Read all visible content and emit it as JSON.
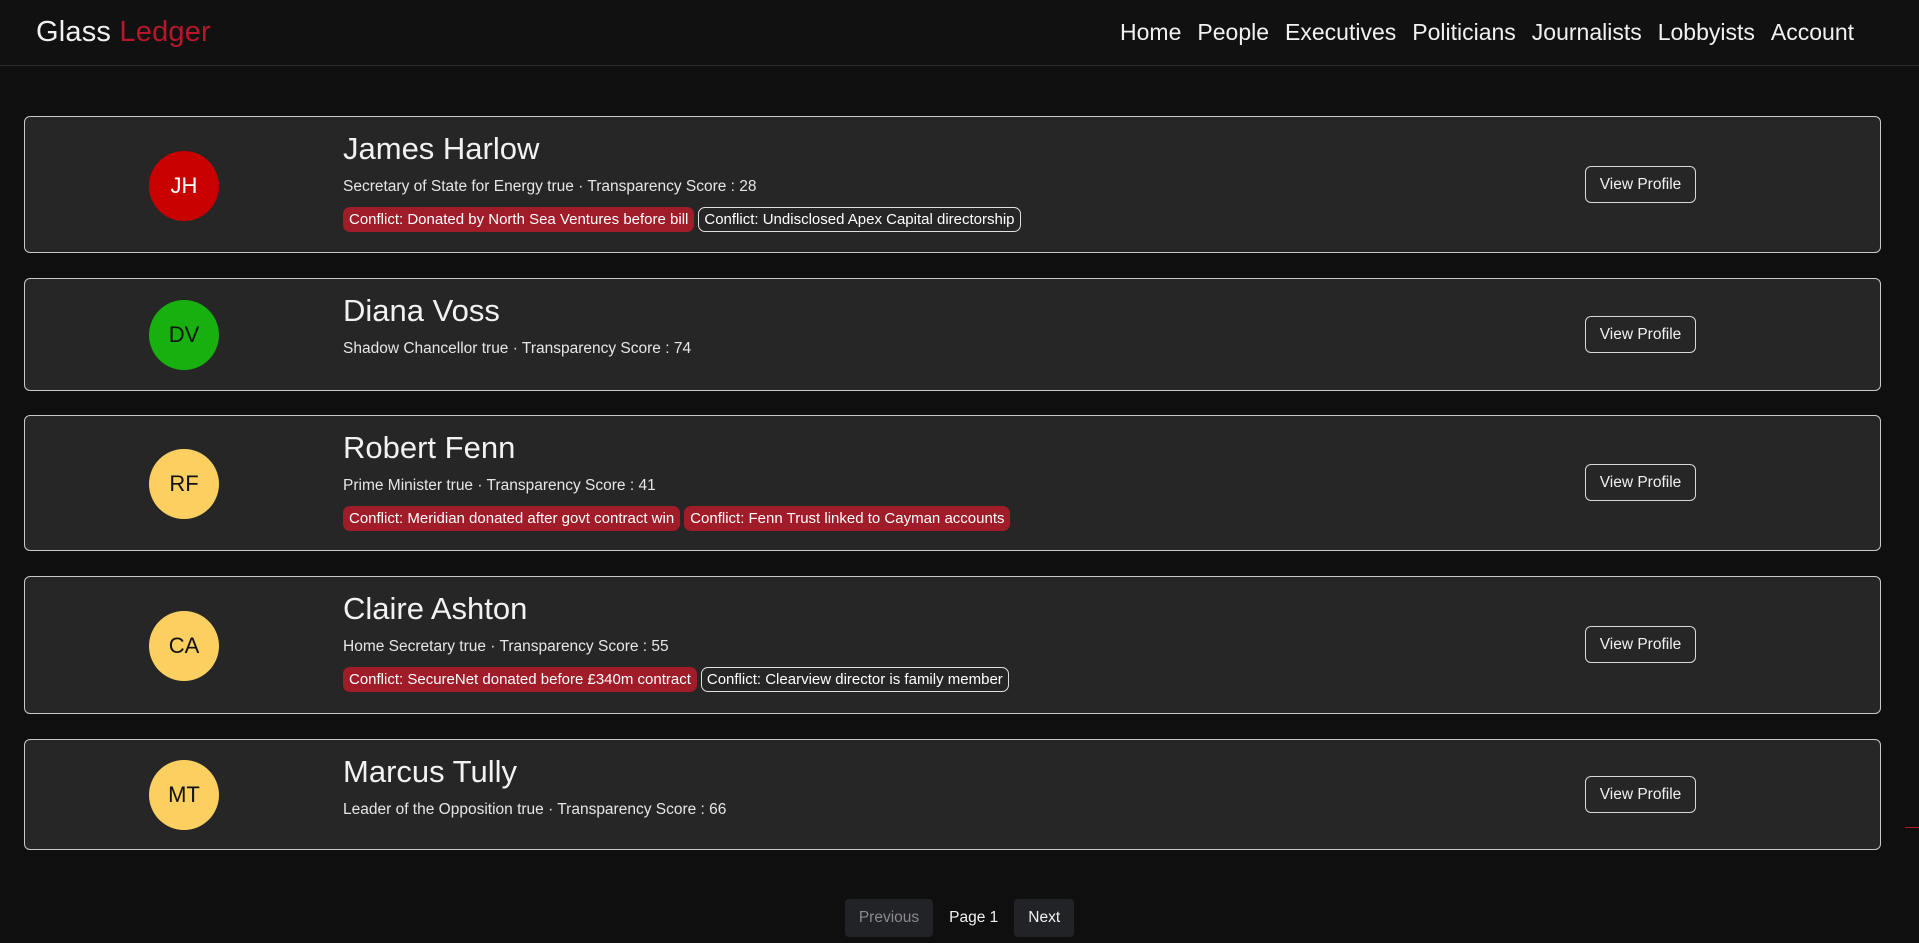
{
  "brand": {
    "part1": "Glass",
    "part2": "Ledger",
    "accent": "#b5182a"
  },
  "nav": {
    "items": [
      "Home",
      "People",
      "Executives",
      "Politicians",
      "Journalists",
      "Lobbyists",
      "Account"
    ]
  },
  "people": [
    {
      "initials": "JH",
      "avatar_color": "#c80000",
      "avatar_text_color": "#ffffff",
      "name": "James Harlow",
      "meta": "Secretary of State for Energy true · Transparency Score : 28",
      "tags": [
        {
          "text": "Conflict: Donated by North Sea Ventures before bill",
          "style": "red"
        },
        {
          "text": "Conflict: Undisclosed Apex Capital directorship",
          "style": "outline"
        }
      ],
      "button": "View Profile"
    },
    {
      "initials": "DV",
      "avatar_color": "#17b00f",
      "avatar_text_color": "#111111",
      "name": "Diana Voss",
      "meta": "Shadow Chancellor true · Transparency Score : 74",
      "tags": [],
      "button": "View Profile"
    },
    {
      "initials": "RF",
      "avatar_color": "#fbd061",
      "avatar_text_color": "#111111",
      "name": "Robert Fenn",
      "meta": "Prime Minister true · Transparency Score : 41",
      "tags": [
        {
          "text": "Conflict: Meridian donated after govt contract win",
          "style": "red"
        },
        {
          "text": "Conflict: Fenn Trust linked to Cayman accounts",
          "style": "red"
        }
      ],
      "button": "View Profile"
    },
    {
      "initials": "CA",
      "avatar_color": "#fbd061",
      "avatar_text_color": "#111111",
      "name": "Claire Ashton",
      "meta": "Home Secretary true · Transparency Score : 55",
      "tags": [
        {
          "text": "Conflict: SecureNet donated before £340m contract",
          "style": "red"
        },
        {
          "text": "Conflict: Clearview director is family member",
          "style": "outline"
        }
      ],
      "button": "View Profile"
    },
    {
      "initials": "MT",
      "avatar_color": "#fbd061",
      "avatar_text_color": "#111111",
      "name": "Marcus Tully",
      "meta": "Leader of the Opposition true · Transparency Score : 66",
      "tags": [],
      "button": "View Profile"
    }
  ],
  "pagination": {
    "previous": "Previous",
    "page_label": "Page 1",
    "next": "Next"
  }
}
